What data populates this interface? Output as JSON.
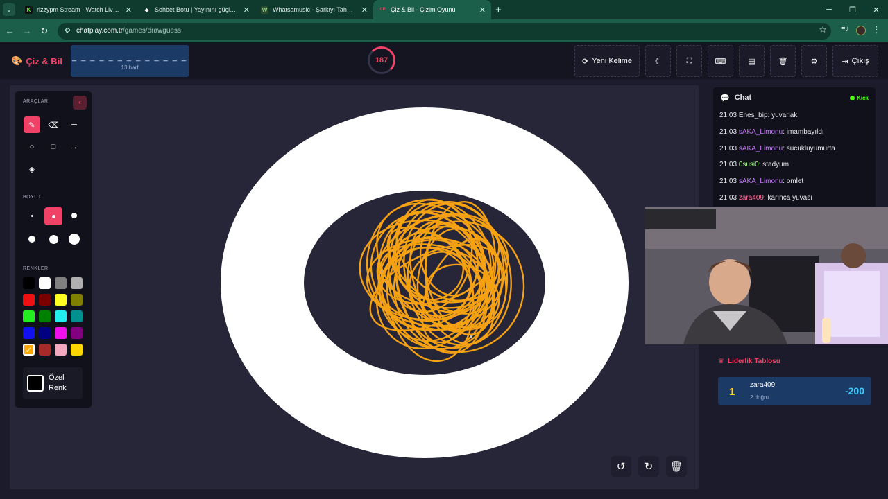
{
  "browser": {
    "tabs": [
      {
        "title": "rizzypm Stream - Watch Live on Kick",
        "icon": "K",
        "icon_color": "#53fc18"
      },
      {
        "title": "Sohbet Botu | Yayınını güçlendir",
        "icon": "◆",
        "icon_color": "#e8e8e8"
      },
      {
        "title": "Whatsamusic - Şarkıyı Tahmin Et",
        "icon": "W",
        "icon_color": "#8fd18f"
      },
      {
        "title": "Çiz & Bil - Çizim Oyunu",
        "icon": "CP",
        "icon_color": "#ef4266"
      }
    ],
    "url_host": "chatplay.com.tr",
    "url_path": "/games/drawguess"
  },
  "game": {
    "logo": "Çiz & Bil",
    "word_hint": "_ _ _ _ _ _ _ _ _ _ _ _ _",
    "letter_count": "13 harf",
    "timer": "187",
    "timer_progress": 0.62,
    "buttons": {
      "new_word": "Yeni Kelime",
      "exit": "Çıkış"
    }
  },
  "tools": {
    "tools_title": "ARAÇLAR",
    "size_title": "BOYUT",
    "colors_title": "RENKLER",
    "custom_color": "Özel Renk",
    "palette": [
      "#000000",
      "#ffffff",
      "#808080",
      "#b0b0b0",
      "#ee1111",
      "#7a0000",
      "#ffff22",
      "#808000",
      "#22ee22",
      "#008000",
      "#22eeee",
      "#009090",
      "#1111ee",
      "#000080",
      "#ee11ee",
      "#800080",
      "#ffa500",
      "#a52a2a",
      "#f4a8c0",
      "#ffd700"
    ],
    "selected_color": "#ffa500",
    "selected_tool": "pencil",
    "selected_size": "medium"
  },
  "chat": {
    "title": "Chat",
    "platform": "Kick",
    "messages": [
      {
        "time": "21:03",
        "user": "Enes_bip",
        "text": "yuvarlak",
        "color": "#e8e8f0"
      },
      {
        "time": "21:03",
        "user": "sAKA_Limonu",
        "text": "imambayıldı",
        "color": "#c77dff"
      },
      {
        "time": "21:03",
        "user": "sAKA_Limonu",
        "text": "sucukluyumurta",
        "color": "#c77dff"
      },
      {
        "time": "21:03",
        "user": "0susi0",
        "text": "stadyum",
        "color": "#9dff7a"
      },
      {
        "time": "21:03",
        "user": "sAKA_Limonu",
        "text": "omlet",
        "color": "#c77dff"
      },
      {
        "time": "21:03",
        "user": "zara409",
        "text": "karınca yuvası",
        "color": "#ff6b9a"
      }
    ]
  },
  "leaderboard": {
    "title": "Liderlik Tablosu",
    "entries": [
      {
        "rank": "1",
        "name": "zara409",
        "correct": "2 doğru",
        "score": "-200"
      }
    ]
  }
}
